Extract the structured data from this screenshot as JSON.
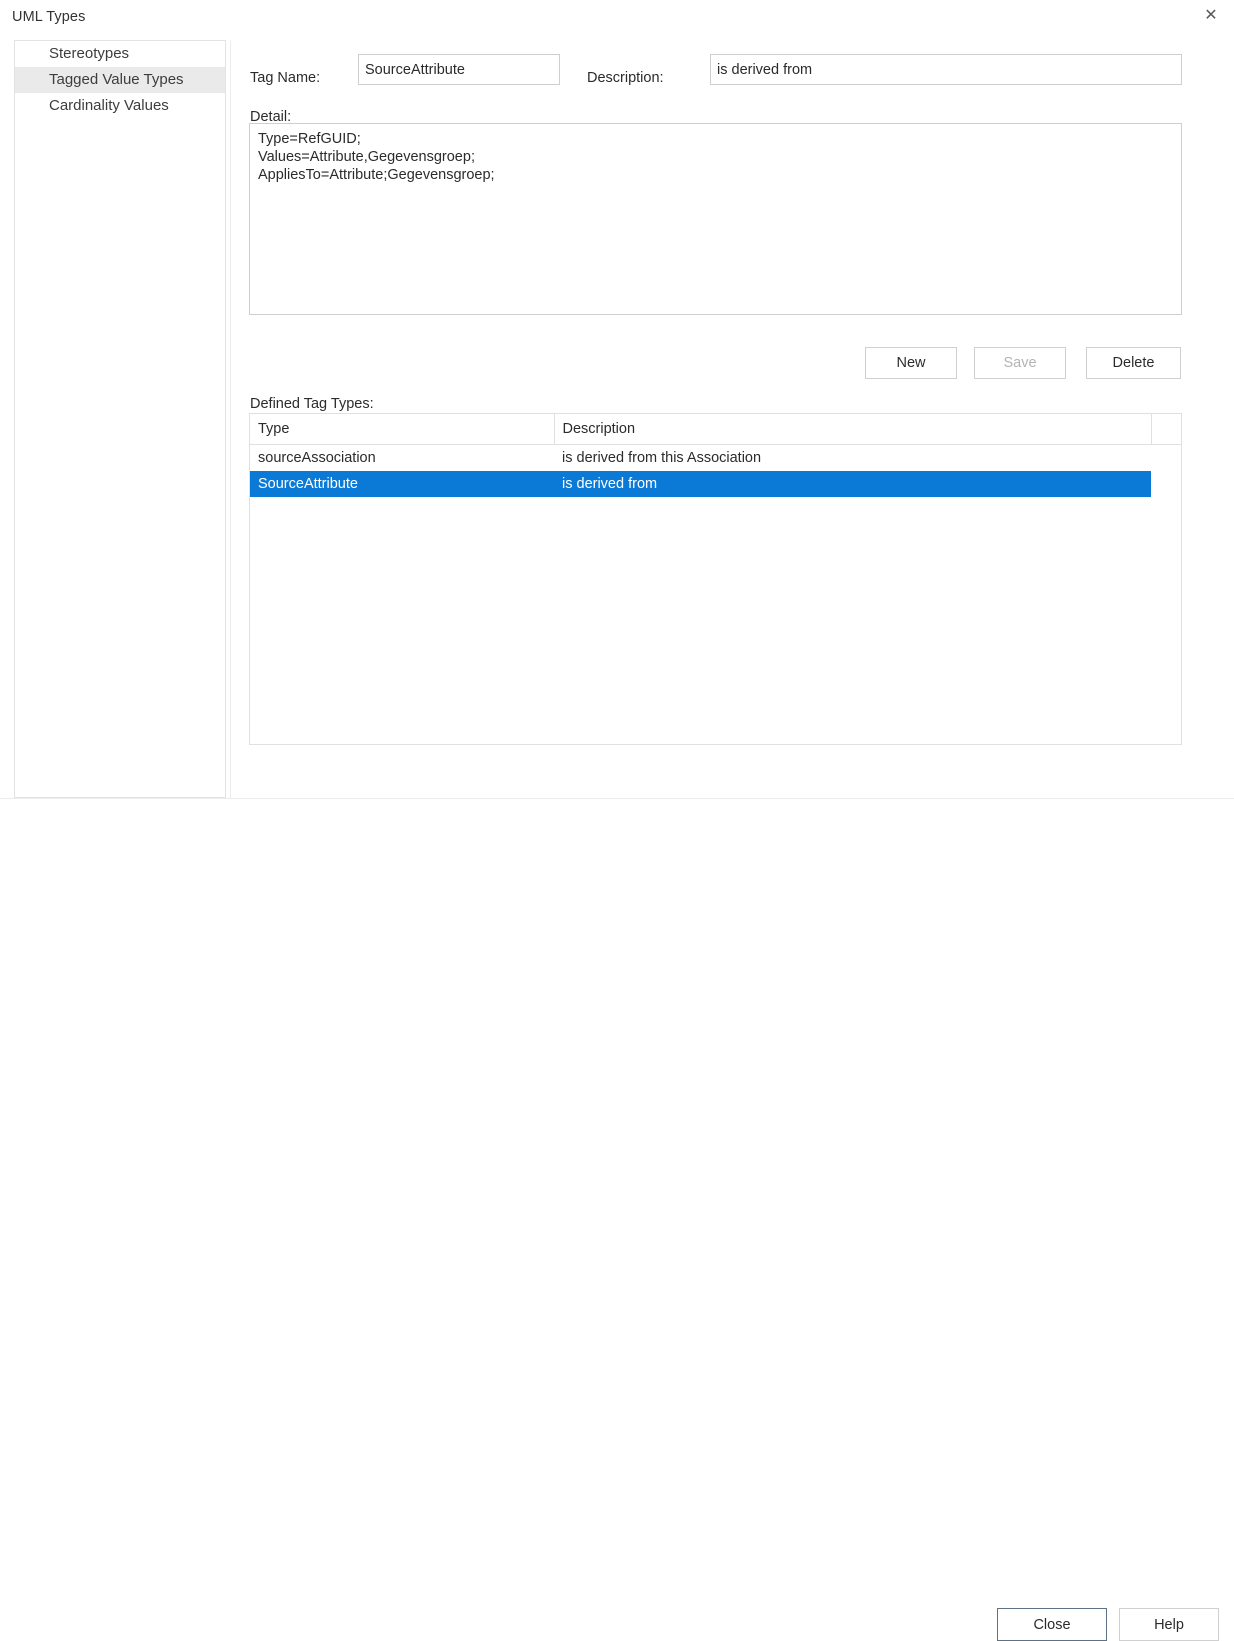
{
  "window": {
    "title": "UML Types",
    "close_icon": "close-x-icon"
  },
  "sidebar": {
    "items": [
      {
        "label": "Stereotypes",
        "selected": false
      },
      {
        "label": "Tagged Value Types",
        "selected": true
      },
      {
        "label": "Cardinality Values",
        "selected": false
      }
    ]
  },
  "form": {
    "tag_name_label": "Tag Name:",
    "tag_name_value": "SourceAttribute",
    "tag_name_placeholder": "",
    "description_label": "Description:",
    "description_value": "is derived from",
    "description_placeholder": "",
    "detail_label": "Detail:",
    "detail_value": "Type=RefGUID;\nValues=Attribute,Gegevensgroep;\nAppliesTo=Attribute;Gegevensgroep;"
  },
  "actions": {
    "new_label": "New",
    "save_label": "Save",
    "save_enabled": false,
    "delete_label": "Delete"
  },
  "table": {
    "caption": "Defined Tag Types:",
    "columns": [
      "Type",
      "Description",
      ""
    ],
    "rows": [
      {
        "type": "sourceAssociation",
        "description": "is derived from this Association",
        "selected": false
      },
      {
        "type": "SourceAttribute",
        "description": "is derived from",
        "selected": true
      }
    ]
  },
  "footer": {
    "close_label": "Close",
    "help_label": "Help"
  },
  "colors": {
    "selection": "#0b7ad6",
    "sidebar_selection": "#eaeaea",
    "border": "#cfcfcf",
    "default_button_border": "#5e7285"
  }
}
